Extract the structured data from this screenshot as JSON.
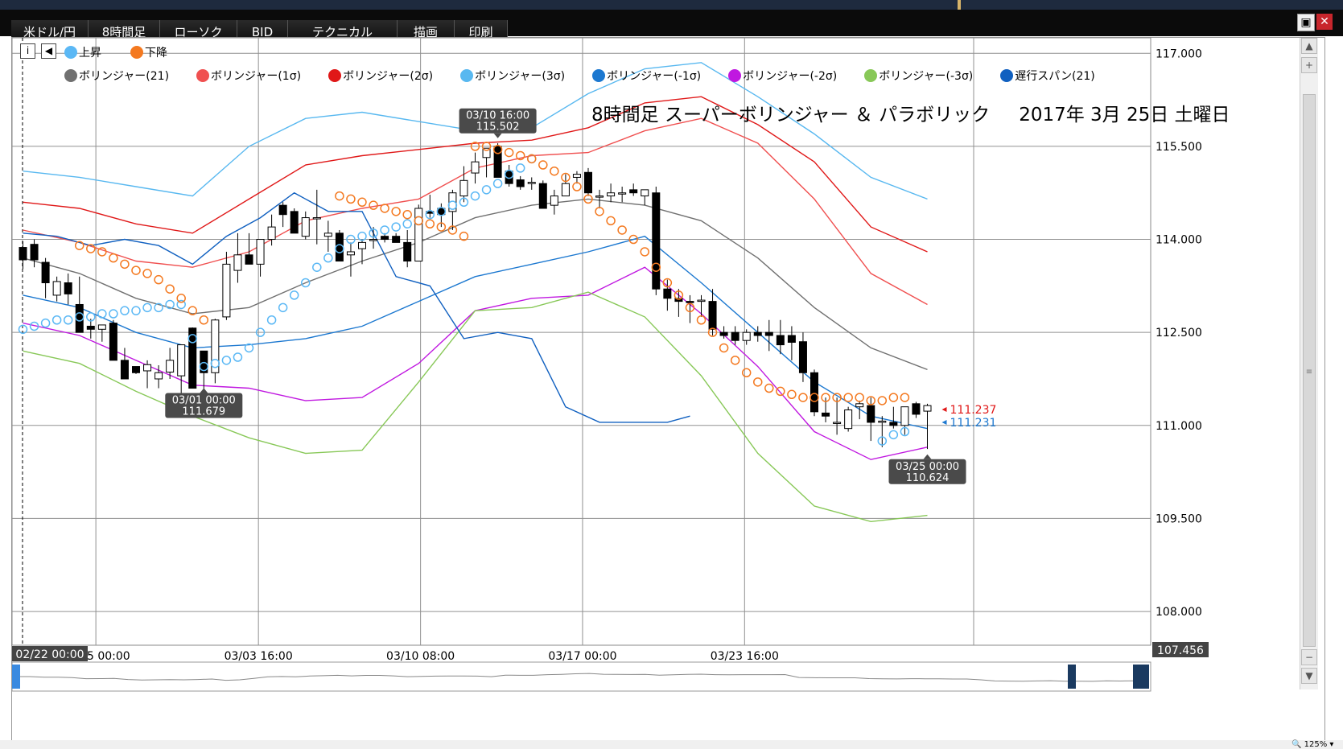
{
  "menu": {
    "items": [
      "米ドル/円",
      "8時間足",
      "ローソク",
      "BID",
      "テクニカル",
      "描画",
      "印刷"
    ]
  },
  "window": {
    "maximize_label": "▣",
    "close_label": "✕"
  },
  "legend": {
    "row1": [
      {
        "label": "上昇",
        "color": "#5bb8f5"
      },
      {
        "label": "下降",
        "color": "#f47920"
      }
    ],
    "row2": [
      {
        "label": "ボリンジャー(21)",
        "color": "#707070"
      },
      {
        "label": "ボリンジャー(1σ)",
        "color": "#f05050"
      },
      {
        "label": "ボリンジャー(2σ)",
        "color": "#e01818"
      },
      {
        "label": "ボリンジャー(3σ)",
        "color": "#58b8f0"
      },
      {
        "label": "ボリンジャー(-1σ)",
        "color": "#1c78d0"
      },
      {
        "label": "ボリンジャー(-2σ)",
        "color": "#c018e0"
      },
      {
        "label": "ボリンジャー(-3σ)",
        "color": "#88c858"
      },
      {
        "label": "遅行スパン(21)",
        "color": "#1060c0"
      }
    ]
  },
  "chart_title": {
    "main": "8時間足 スーパーボリンジャー ＆ パラボリック",
    "date": "2017年 3月 25日 土曜日"
  },
  "chart_data": {
    "type": "candlestick",
    "title": "8時間足 スーパーボリンジャー ＆ パラボリック",
    "ylim": [
      107.456,
      117.25
    ],
    "y_ticks": [
      "117.000",
      "115.500",
      "114.000",
      "112.500",
      "111.000",
      "109.500",
      "108.000"
    ],
    "y_tick_values": [
      117.0,
      115.5,
      114.0,
      112.5,
      111.0,
      109.5,
      108.0
    ],
    "x_tick_labels": [
      "02/25 00:00",
      "03/03 16:00",
      "03/10 08:00",
      "03/17 00:00",
      "03/23 16:00"
    ],
    "x_tick_index": [
      6.45,
      20.83,
      35.17,
      49.5,
      63.83
    ],
    "x_start_label": "02/22 00:00",
    "y_bottom_label": "107.456",
    "grid": true,
    "candles": [
      [
        113.87,
        113.97,
        113.52,
        113.67
      ],
      [
        113.92,
        114.0,
        113.55,
        113.67
      ],
      [
        113.63,
        113.7,
        113.05,
        113.3
      ],
      [
        113.1,
        113.4,
        113.0,
        113.32
      ],
      [
        113.3,
        113.45,
        112.95,
        113.12
      ],
      [
        112.95,
        113.4,
        112.8,
        112.5
      ],
      [
        112.6,
        112.72,
        112.4,
        112.55
      ],
      [
        112.55,
        112.6,
        112.35,
        112.62
      ],
      [
        112.65,
        112.7,
        112.1,
        112.05
      ],
      [
        112.05,
        112.25,
        111.98,
        111.75
      ],
      [
        111.95,
        111.92,
        111.83,
        111.85
      ],
      [
        111.88,
        112.05,
        111.6,
        111.98
      ],
      [
        111.75,
        111.97,
        111.6,
        111.85
      ],
      [
        111.86,
        112.25,
        111.75,
        112.05
      ],
      [
        111.8,
        112.26,
        111.5,
        112.3
      ],
      [
        112.57,
        112.58,
        112.3,
        111.6
      ],
      [
        112.2,
        112.2,
        111.5,
        111.85
      ],
      [
        111.85,
        112.72,
        111.68,
        112.7
      ],
      [
        112.75,
        113.8,
        112.7,
        113.6
      ],
      [
        113.5,
        114.1,
        113.3,
        113.75
      ],
      [
        113.75,
        114.1,
        113.6,
        113.6
      ],
      [
        113.6,
        114.0,
        113.4,
        114.0
      ],
      [
        114.0,
        114.4,
        113.9,
        114.2
      ],
      [
        114.55,
        114.6,
        114.2,
        114.4
      ],
      [
        114.45,
        114.5,
        114.1,
        114.1
      ],
      [
        114.05,
        114.45,
        114.0,
        114.35
      ],
      [
        114.35,
        114.8,
        113.92,
        114.35
      ],
      [
        114.05,
        114.3,
        113.8,
        114.1
      ],
      [
        114.1,
        114.15,
        113.65,
        113.65
      ],
      [
        113.75,
        113.95,
        113.4,
        113.8
      ],
      [
        113.85,
        114.0,
        113.6,
        113.95
      ],
      [
        114.0,
        114.2,
        113.85,
        114.0
      ],
      [
        114.05,
        114.1,
        113.95,
        114.0
      ],
      [
        114.05,
        114.1,
        113.95,
        113.95
      ],
      [
        113.95,
        114.15,
        113.55,
        113.65
      ],
      [
        113.65,
        114.56,
        113.65,
        114.5
      ],
      [
        114.45,
        114.72,
        114.35,
        114.42
      ],
      [
        114.5,
        114.58,
        114.2,
        114.4
      ],
      [
        114.45,
        114.8,
        114.15,
        114.75
      ],
      [
        114.7,
        115.18,
        114.6,
        114.95
      ],
      [
        115.07,
        115.4,
        114.9,
        115.25
      ],
      [
        115.32,
        115.45,
        115.0,
        115.47
      ],
      [
        115.5,
        115.55,
        115.12,
        115.0
      ],
      [
        115.1,
        115.2,
        114.85,
        114.9
      ],
      [
        114.96,
        115.02,
        114.8,
        114.85
      ],
      [
        114.9,
        115.0,
        114.8,
        114.92
      ],
      [
        114.9,
        114.95,
        114.5,
        114.5
      ],
      [
        114.55,
        114.8,
        114.4,
        114.7
      ],
      [
        114.7,
        115.05,
        114.7,
        114.9
      ],
      [
        115.0,
        115.1,
        114.9,
        115.05
      ],
      [
        115.08,
        115.15,
        114.7,
        114.75
      ],
      [
        114.7,
        114.8,
        114.5,
        114.7
      ],
      [
        114.7,
        114.9,
        114.6,
        114.75
      ],
      [
        114.75,
        114.85,
        114.6,
        114.75
      ],
      [
        114.8,
        114.9,
        114.7,
        114.75
      ],
      [
        114.7,
        114.8,
        114.55,
        114.8
      ],
      [
        114.75,
        114.85,
        113.1,
        113.2
      ],
      [
        113.2,
        113.35,
        112.85,
        113.05
      ],
      [
        113.05,
        113.2,
        112.75,
        113.0
      ],
      [
        113.0,
        113.1,
        112.65,
        112.98
      ],
      [
        113.0,
        113.1,
        112.75,
        113.02
      ],
      [
        113.0,
        113.2,
        112.45,
        112.55
      ],
      [
        112.5,
        112.6,
        112.4,
        112.45
      ],
      [
        112.5,
        112.6,
        112.3,
        112.37
      ],
      [
        112.37,
        112.55,
        112.3,
        112.5
      ],
      [
        112.5,
        112.6,
        112.35,
        112.45
      ],
      [
        112.5,
        112.7,
        112.2,
        112.45
      ],
      [
        112.45,
        112.7,
        112.15,
        112.3
      ],
      [
        112.45,
        112.6,
        112.05,
        112.34
      ],
      [
        112.35,
        112.5,
        111.7,
        111.85
      ],
      [
        111.85,
        111.9,
        111.15,
        111.22
      ],
      [
        111.2,
        111.45,
        111.05,
        111.15
      ],
      [
        111.05,
        111.45,
        110.85,
        111.05
      ],
      [
        110.95,
        111.3,
        110.9,
        111.25
      ],
      [
        111.3,
        111.4,
        111.1,
        111.35
      ],
      [
        111.32,
        111.45,
        110.75,
        111.05
      ],
      [
        111.05,
        111.15,
        110.65,
        111.07
      ],
      [
        111.05,
        111.3,
        110.95,
        111.0
      ],
      [
        111.0,
        111.3,
        110.85,
        111.3
      ],
      [
        111.35,
        111.38,
        111.12,
        111.18
      ],
      [
        111.23,
        111.35,
        110.62,
        111.32
      ]
    ],
    "series": [
      {
        "name": "ボリンジャー(21)",
        "x": [
          0,
          5,
          10,
          15,
          20,
          25,
          30,
          35,
          40,
          45,
          50,
          55,
          60,
          65,
          70,
          75,
          80
        ],
        "y": [
          113.7,
          113.45,
          113.05,
          112.8,
          112.9,
          113.3,
          113.65,
          113.95,
          114.35,
          114.55,
          114.65,
          114.55,
          114.3,
          113.7,
          112.9,
          112.25,
          111.9
        ]
      },
      {
        "name": "ボリンジャー(1σ)",
        "x": [
          0,
          5,
          10,
          15,
          20,
          25,
          30,
          35,
          40,
          45,
          50,
          55,
          60,
          65,
          70,
          75,
          80
        ],
        "y": [
          114.15,
          113.95,
          113.65,
          113.55,
          113.8,
          114.3,
          114.5,
          114.65,
          115.15,
          115.35,
          115.4,
          115.75,
          115.95,
          115.55,
          114.65,
          113.45,
          112.95
        ]
      },
      {
        "name": "ボリンジャー(2σ)",
        "x": [
          0,
          5,
          10,
          15,
          20,
          25,
          30,
          35,
          40,
          45,
          50,
          55,
          60,
          65,
          70,
          75,
          80
        ],
        "y": [
          114.6,
          114.5,
          114.25,
          114.1,
          114.65,
          115.2,
          115.35,
          115.45,
          115.55,
          115.6,
          115.8,
          116.2,
          116.3,
          115.85,
          115.25,
          114.2,
          113.8
        ]
      },
      {
        "name": "ボリンジャー(3σ)",
        "x": [
          0,
          5,
          10,
          15,
          20,
          25,
          30,
          35,
          40,
          45,
          50,
          55,
          60,
          65,
          70,
          75,
          80
        ],
        "y": [
          115.1,
          115.0,
          114.85,
          114.7,
          115.5,
          115.95,
          116.05,
          115.9,
          115.75,
          115.8,
          116.35,
          116.75,
          116.85,
          116.3,
          115.7,
          115.0,
          114.65
        ]
      },
      {
        "name": "ボリンジャー(-1σ)",
        "x": [
          0,
          5,
          10,
          15,
          20,
          25,
          30,
          35,
          40,
          45,
          50,
          55,
          60,
          65,
          70,
          75,
          80
        ],
        "y": [
          113.1,
          112.9,
          112.5,
          112.25,
          112.3,
          112.4,
          112.6,
          113.0,
          113.4,
          113.6,
          113.8,
          114.05,
          113.3,
          112.5,
          111.7,
          111.15,
          110.95
        ]
      },
      {
        "name": "ボリンジャー(-2σ)",
        "x": [
          0,
          5,
          10,
          15,
          20,
          25,
          30,
          35,
          40,
          45,
          50,
          55,
          60,
          65,
          70,
          75,
          80
        ],
        "y": [
          112.65,
          112.45,
          112.05,
          111.65,
          111.6,
          111.4,
          111.45,
          112.0,
          112.85,
          113.05,
          113.1,
          113.55,
          112.8,
          111.95,
          110.9,
          110.45,
          110.65
        ]
      },
      {
        "name": "ボリンジャー(-3σ)",
        "x": [
          0,
          5,
          10,
          15,
          20,
          25,
          30,
          35,
          40,
          45,
          50,
          55,
          60,
          65,
          70,
          75,
          80
        ],
        "y": [
          112.2,
          112.0,
          111.55,
          111.15,
          110.8,
          110.55,
          110.6,
          111.7,
          112.85,
          112.9,
          113.15,
          112.75,
          111.8,
          110.55,
          109.7,
          109.45,
          109.55
        ]
      },
      {
        "name": "遅行スパン(21)",
        "x": [
          0,
          3,
          6,
          9,
          12,
          15,
          18,
          21,
          24,
          27,
          30,
          33,
          36,
          39,
          42,
          45,
          48,
          51,
          54,
          57,
          59
        ],
        "y": [
          114.1,
          114.05,
          113.9,
          114.0,
          113.9,
          113.6,
          114.05,
          114.35,
          114.75,
          114.45,
          114.45,
          113.4,
          113.25,
          112.4,
          112.5,
          112.4,
          111.3,
          111.05,
          111.05,
          111.05,
          111.15
        ]
      }
    ],
    "parabolic_sar": {
      "up": {
        "name": "上昇",
        "x": [
          0,
          1,
          2,
          3,
          4,
          5,
          6,
          7,
          8,
          9,
          10,
          11,
          12,
          13,
          14,
          15,
          16,
          17,
          18,
          19,
          20,
          21,
          22,
          23,
          24,
          25,
          26,
          27,
          28,
          29,
          30,
          31,
          32,
          33,
          34,
          35,
          36,
          37,
          38,
          39,
          40,
          41,
          42,
          43,
          44,
          45,
          76,
          77,
          78
        ],
        "y": [
          112.55,
          112.6,
          112.65,
          112.7,
          112.7,
          112.75,
          112.75,
          112.8,
          112.8,
          112.85,
          112.85,
          112.9,
          112.9,
          112.95,
          112.95,
          112.4,
          111.95,
          112.0,
          112.05,
          112.1,
          112.25,
          112.5,
          112.7,
          112.9,
          113.1,
          113.3,
          113.55,
          113.7,
          113.85,
          114.0,
          114.05,
          114.1,
          114.15,
          114.2,
          114.25,
          114.3,
          114.4,
          114.45,
          114.55,
          114.6,
          114.7,
          114.8,
          114.9,
          115.05,
          115.15,
          115.3,
          110.75,
          110.85,
          110.9
        ]
      },
      "down": {
        "name": "下降",
        "x": [
          5,
          6,
          7,
          8,
          9,
          10,
          11,
          12,
          13,
          14,
          15,
          16,
          28,
          29,
          30,
          31,
          32,
          33,
          34,
          35,
          36,
          37,
          38,
          39,
          40,
          41,
          42,
          43,
          44,
          45,
          46,
          47,
          48,
          49,
          50,
          51,
          52,
          53,
          54,
          55,
          56,
          57,
          58,
          59,
          60,
          61,
          62,
          63,
          64,
          65,
          66,
          67,
          68,
          69,
          70,
          71,
          72,
          73,
          74,
          75,
          76,
          77,
          78
        ],
        "y": [
          113.9,
          113.85,
          113.8,
          113.7,
          113.6,
          113.5,
          113.45,
          113.35,
          113.2,
          113.05,
          112.85,
          112.7,
          114.7,
          114.65,
          114.6,
          114.55,
          114.5,
          114.45,
          114.4,
          114.3,
          114.25,
          114.2,
          114.15,
          114.05,
          115.5,
          115.5,
          115.45,
          115.4,
          115.35,
          115.3,
          115.2,
          115.1,
          115.0,
          114.85,
          114.65,
          114.45,
          114.3,
          114.15,
          114.0,
          113.8,
          113.55,
          113.3,
          113.1,
          112.9,
          112.7,
          112.5,
          112.25,
          112.05,
          111.85,
          111.7,
          111.6,
          111.55,
          111.5,
          111.45,
          111.45,
          111.45,
          111.45,
          111.45,
          111.45,
          111.4,
          111.4,
          111.45,
          111.45
        ]
      }
    },
    "annotations": [
      {
        "label": "03/10 16:00",
        "value": "115.502",
        "index": 42
      },
      {
        "label": "03/01 00:00",
        "value": "111.679",
        "index": 16
      },
      {
        "label": "03/25 00:00",
        "value": "110.624",
        "index": 80
      }
    ],
    "price_markers": [
      {
        "value": "111.237",
        "color": "#e01818"
      },
      {
        "value": "111.231",
        "color": "#1c78d0"
      }
    ]
  },
  "scrollbar": {
    "up": "▲",
    "down": "▼",
    "grip": "≡",
    "plus": "+",
    "minus": "−"
  },
  "status": {
    "zoom": "125%"
  }
}
